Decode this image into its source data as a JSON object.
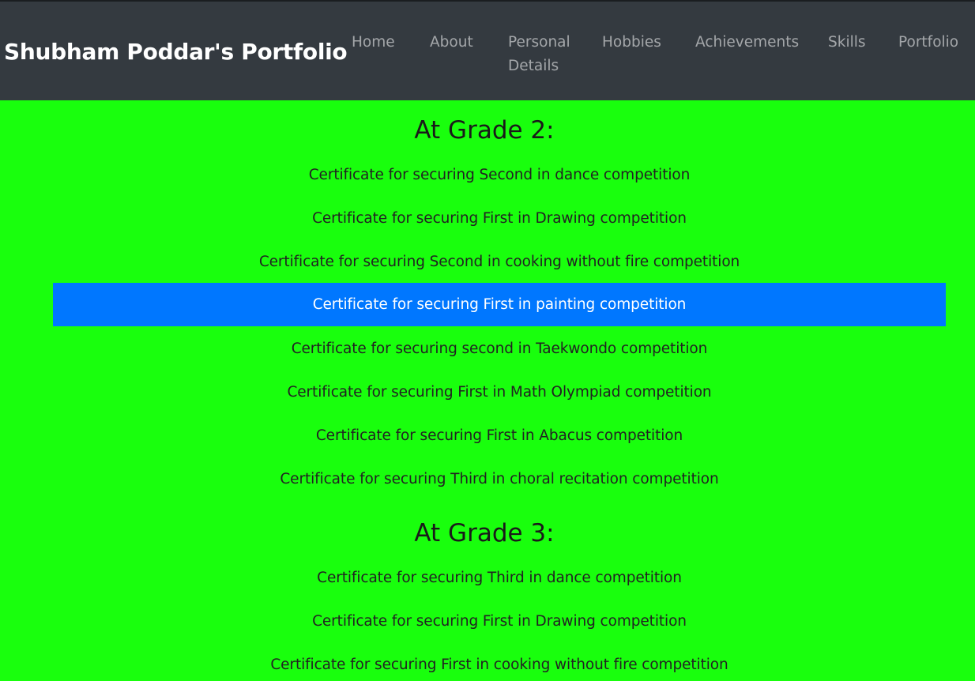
{
  "navbar": {
    "brand": "Shubham Poddar's Portfolio",
    "links": [
      "Home",
      "About",
      "Personal Details",
      "Hobbies",
      "Achievements",
      "Skills",
      "Portfolio"
    ]
  },
  "sections": [
    {
      "heading": "At Grade 2:",
      "items": [
        "Certificate for securing Second in dance competition",
        "Certificate for securing First in Drawing competition",
        "Certificate for securing Second in cooking without fire competition",
        "Certificate for securing First in painting competition",
        "Certificate for securing second in Taekwondo competition",
        "Certificate for securing First in Math Olympiad competition",
        "Certificate for securing First in Abacus competition",
        "Certificate for securing Third in choral recitation competition"
      ],
      "active_index": 3
    },
    {
      "heading": "At Grade 3:",
      "items": [
        "Certificate for securing Third in dance competition",
        "Certificate for securing First in Drawing competition",
        "Certificate for securing First in cooking without fire competition"
      ]
    }
  ],
  "colors": {
    "page_background": "#19ff0d",
    "navbar_background": "#343a40",
    "active_item": "#0077ff"
  }
}
